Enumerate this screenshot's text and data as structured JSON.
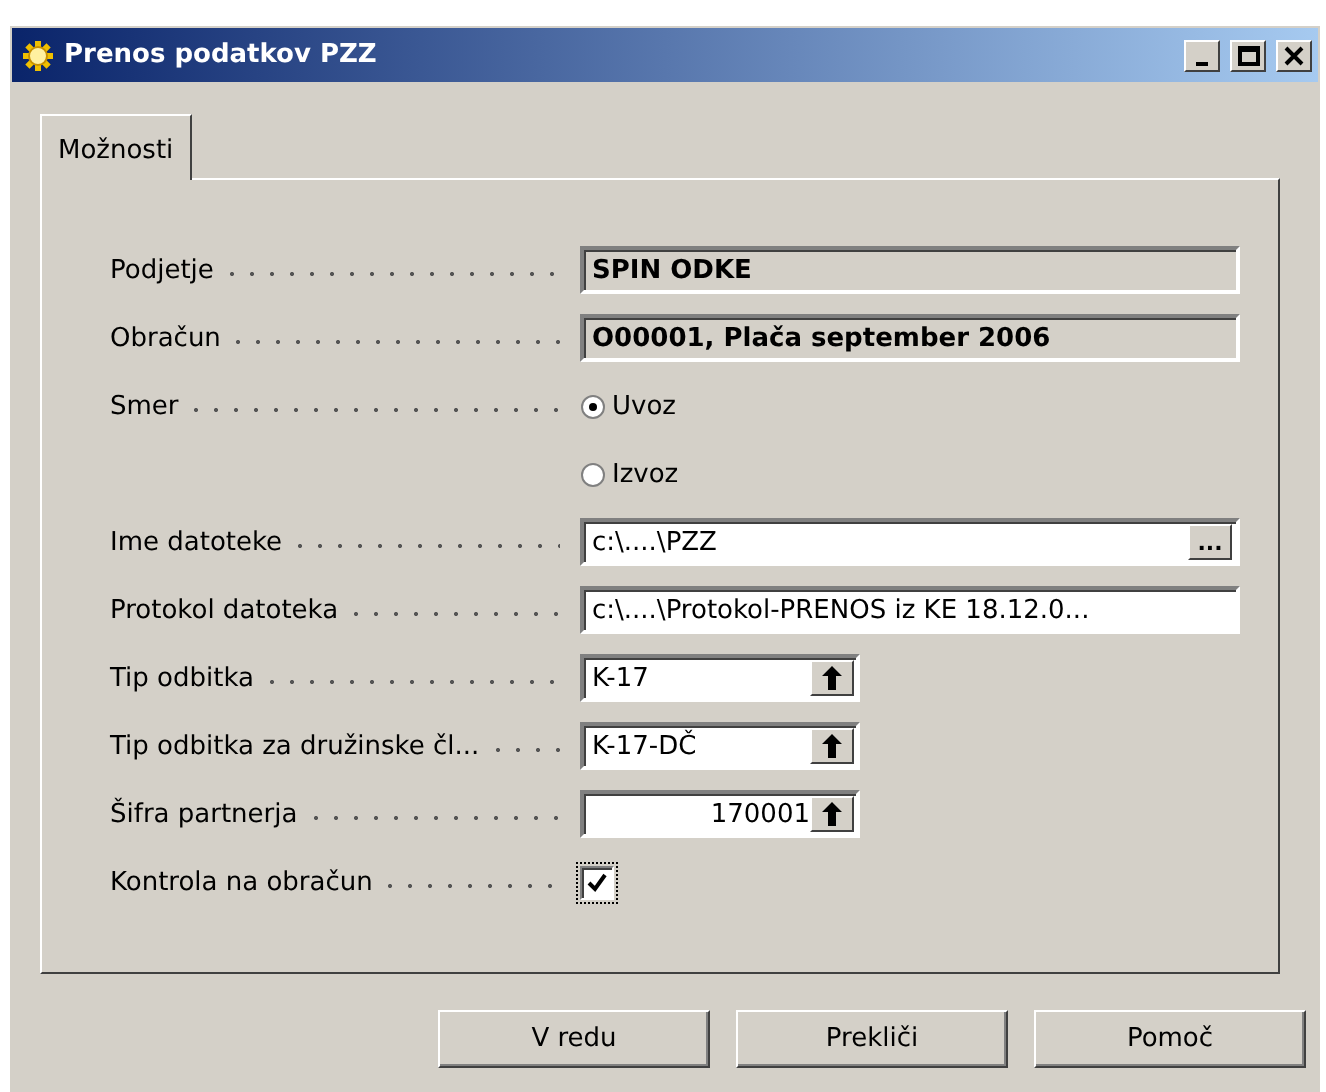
{
  "window": {
    "title": "Prenos podatkov PZZ"
  },
  "tabs": [
    {
      "label": "Možnosti",
      "selected": true
    }
  ],
  "fields": [
    {
      "kind": "readonly",
      "label": "Podjetje",
      "value": "SPIN ODKE"
    },
    {
      "kind": "readonly",
      "label": "Obračun",
      "value": "O00001, Plača september 2006"
    },
    {
      "kind": "radio",
      "label": "Smer",
      "options": [
        {
          "label": "Uvoz",
          "selected": true
        },
        {
          "label": "Izvoz",
          "selected": false
        }
      ]
    },
    {
      "kind": "file",
      "label": "Ime datoteke",
      "value": "c:\\....\\PZZ",
      "button": "..."
    },
    {
      "kind": "text",
      "label": "Protokol datoteka",
      "value": "c:\\....\\Protokol-PRENOS iz KE 18.12.0..."
    },
    {
      "kind": "lookup",
      "label": "Tip odbitka",
      "value": "K-17"
    },
    {
      "kind": "lookup",
      "label": "Tip odbitka za družinske čl...",
      "value": "K-17-DČ"
    },
    {
      "kind": "number-lookup",
      "label": "Šifra partnerja",
      "value": "170001"
    },
    {
      "kind": "checkbox",
      "label": "Kontrola na obračun",
      "checked": true
    }
  ],
  "buttons": [
    "V redu",
    "Prekliči",
    "Pomoč"
  ]
}
